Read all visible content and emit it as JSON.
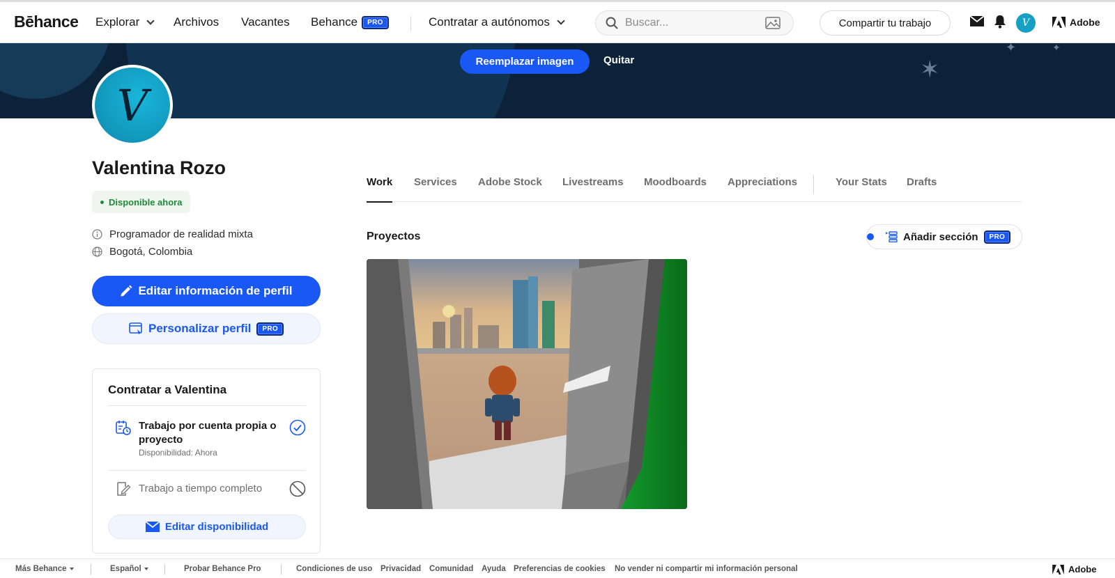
{
  "nav": {
    "logo": "Bēhance",
    "explore": "Explorar",
    "files": "Archivos",
    "jobs": "Vacantes",
    "behance": "Behance",
    "pro": "PRO",
    "hire": "Contratar a autónomos",
    "search_placeholder": "Buscar...",
    "share": "Compartir tu trabajo",
    "avatar_letter": "V",
    "adobe": "Adobe"
  },
  "banner": {
    "replace": "Reemplazar imagen",
    "remove": "Quitar"
  },
  "profile": {
    "avatar_letter": "V",
    "name": "Valentina Rozo",
    "status": "Disponible ahora",
    "occupation": "Programador de realidad mixta",
    "location": "Bogotá, Colombia",
    "edit_profile": "Editar información de perfil",
    "customize": "Personalizar perfil",
    "pro": "PRO"
  },
  "hire_card": {
    "title": "Contratar a Valentina",
    "freelance_label": "Trabajo por cuenta propia o proyecto",
    "freelance_sub": "Disponibilidad: Ahora",
    "fulltime_label": "Trabajo a tiempo completo",
    "edit_availability": "Editar disponibilidad"
  },
  "tabs": [
    "Work",
    "Services",
    "Adobe Stock",
    "Livestreams",
    "Moodboards",
    "Appreciations",
    "Your Stats",
    "Drafts"
  ],
  "projects": {
    "label": "Proyectos",
    "add_section": "Añadir sección",
    "pro": "PRO"
  },
  "footer": {
    "more": "Más Behance",
    "language": "Español",
    "try_pro": "Probar Behance Pro",
    "links": [
      "Condiciones de uso",
      "Privacidad",
      "Comunidad",
      "Ayuda",
      "Preferencias de cookies",
      "No vender ni compartir mi información personal"
    ],
    "adobe": "Adobe"
  },
  "colors": {
    "accent": "#1958f5",
    "banner": "#0c2238",
    "available_green": "#1f8a3a"
  }
}
